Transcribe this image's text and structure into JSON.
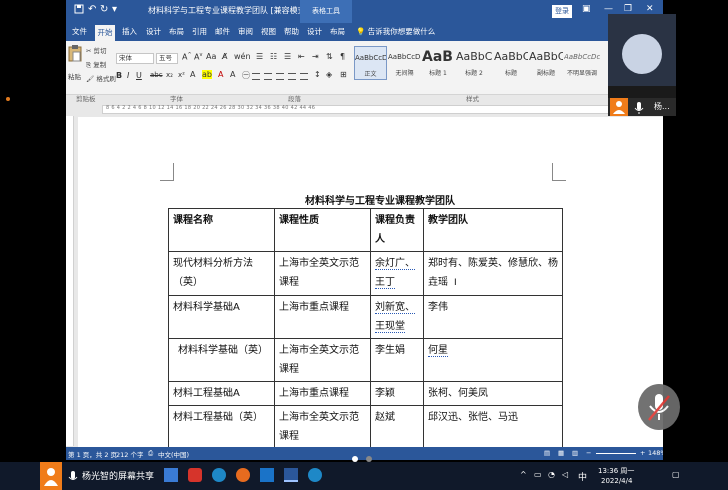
{
  "window": {
    "title": "材料科学与工程专业课程教学团队 [兼容模式] - Word",
    "context_tab": "表格工具",
    "login_button": "登录"
  },
  "ribbon_tabs": [
    "文件",
    "开始",
    "插入",
    "设计",
    "布局",
    "引用",
    "邮件",
    "审阅",
    "视图",
    "帮助",
    "设计",
    "布局"
  ],
  "tell_me": "告诉我你想要做什么",
  "clipboard": {
    "paste": "粘贴",
    "cut": "剪切",
    "copy": "复制",
    "format_painter": "格式刷"
  },
  "font": {
    "name": "宋体",
    "size": "五号"
  },
  "styles": [
    {
      "preview": "AaBbCcDc",
      "name": "正文"
    },
    {
      "preview": "AaBbCcDc",
      "name": "无间隔"
    },
    {
      "preview": "AaBl",
      "name": "标题 1"
    },
    {
      "preview": "AaBbC",
      "name": "标题 2"
    },
    {
      "preview": "AaBbC",
      "name": "标题"
    },
    {
      "preview": "AaBbC",
      "name": "副标题"
    },
    {
      "preview": "AaBbCcDc",
      "name": "不明显强调"
    }
  ],
  "group_labels": {
    "clipboard": "剪贴板",
    "font": "字体",
    "paragraph": "段落",
    "styles": "样式"
  },
  "ruler_numbers": "8 6 4 2    2 4 6 8 10 12 14 16 18 20 22 24 26 28 30 32 34 36 38 40 42 44 46",
  "document": {
    "heading": "材料科学与工程专业课程教学团队",
    "table": {
      "headers": [
        "课程名称",
        "课程性质",
        "课程负责人",
        "教学团队"
      ],
      "rows": [
        [
          "现代材料分析方法（英）",
          "上海市全英文示范课程",
          "余灯广、王丁",
          "郑时有、陈爱英、修慧欣、杨垚瑶"
        ],
        [
          "材料科学基础A",
          "上海市重点课程",
          "刘新宽、王现堂",
          "李伟"
        ],
        [
          "材料科学基础（英）",
          "上海市全英文示范课程",
          "李生娟",
          "何星"
        ],
        [
          "材料工程基础A",
          "上海市重点课程",
          "李颖",
          "张柯、何美凤"
        ],
        [
          "材料工程基础（英）",
          "上海市全英文示范课程",
          "赵斌",
          "邱汉迅、张恺、马迅"
        ]
      ]
    }
  },
  "status_bar": {
    "page": "第 1 页，共 2 页",
    "words": "212 个字",
    "language": "中文(中国)",
    "zoom": "148%"
  },
  "video": {
    "name": "杨..."
  },
  "taskbar": {
    "share_label": "杨光智的屏幕共享",
    "time": "13:36 周一",
    "date": "2022/4/4",
    "ime": "中"
  }
}
